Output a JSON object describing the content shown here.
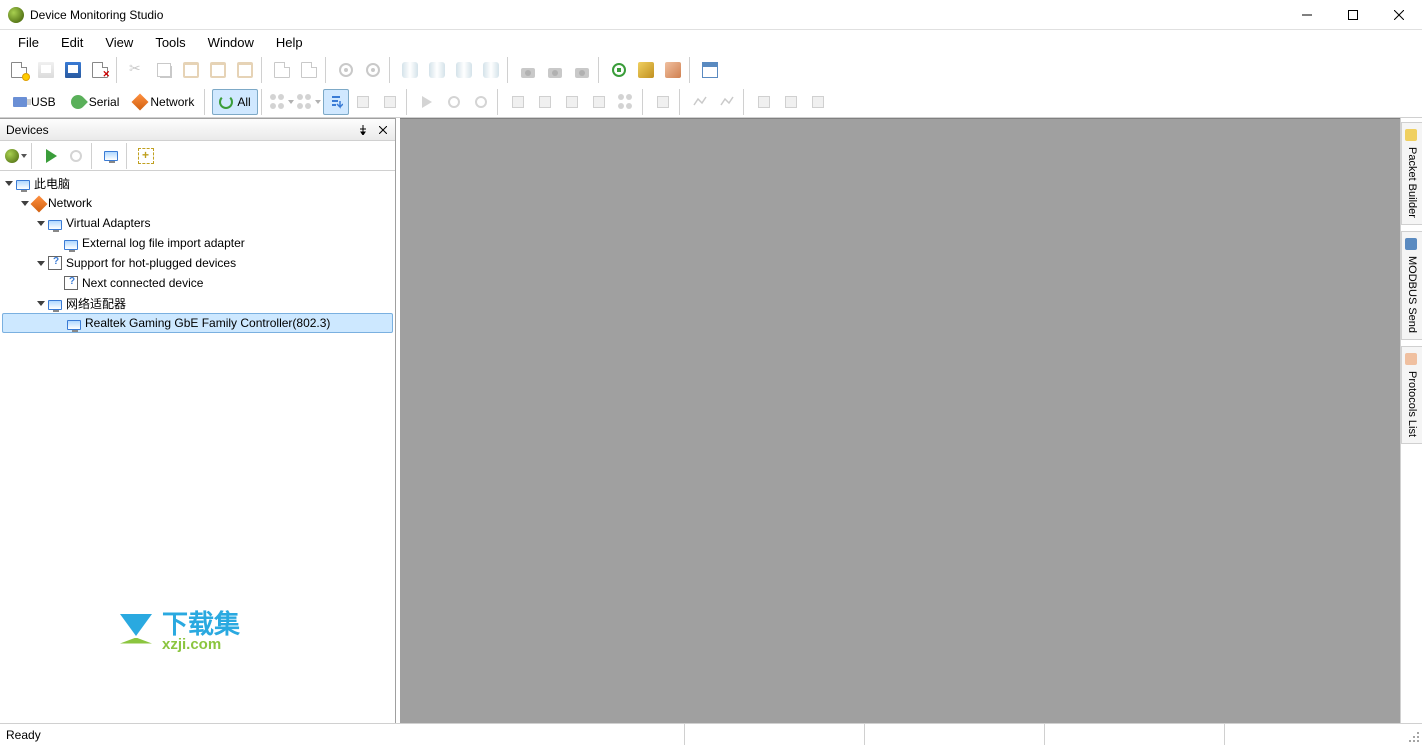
{
  "title": "Device Monitoring Studio",
  "menu": {
    "file": "File",
    "edit": "Edit",
    "view": "View",
    "tools": "Tools",
    "window": "Window",
    "help": "Help"
  },
  "filters": {
    "usb": "USB",
    "serial": "Serial",
    "network": "Network",
    "all": "All"
  },
  "devices_panel": {
    "title": "Devices",
    "tree": {
      "root": "此电脑",
      "network": "Network",
      "virtual_adapters": "Virtual Adapters",
      "external_log": "External log file import adapter",
      "hotplug_support": "Support for hot-plugged devices",
      "next_connected": "Next connected device",
      "net_adapters": "网络适配器",
      "realtek": "Realtek Gaming GbE Family Controller(802.3)"
    }
  },
  "right_tabs": {
    "packet_builder": "Packet Builder",
    "modbus_send": "MODBUS Send",
    "protocols_list": "Protocols List"
  },
  "status": "Ready",
  "watermark": {
    "line1": "下载集",
    "line2": "xzji.com"
  }
}
